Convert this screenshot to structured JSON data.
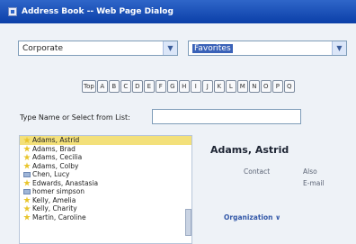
{
  "window": {
    "title": "Address Book -- Web Page Dialog"
  },
  "selects": {
    "directory": "Corporate",
    "group": "Favorites"
  },
  "alphabet": [
    "Top",
    "A",
    "B",
    "C",
    "D",
    "E",
    "F",
    "G",
    "H",
    "I",
    "J",
    "K",
    "L",
    "M",
    "N",
    "O",
    "P",
    "Q"
  ],
  "search": {
    "label": "Type Name or Select from List:",
    "value": ""
  },
  "contacts": [
    {
      "name": "Adams, Astrid",
      "icon": "star-icon",
      "selected": true
    },
    {
      "name": "Adams, Brad",
      "icon": "star-icon"
    },
    {
      "name": "Adams, Cecilia",
      "icon": "star-icon"
    },
    {
      "name": "Adams, Colby",
      "icon": "star-icon"
    },
    {
      "name": "Chen, Lucy",
      "icon": "contact-card-icon"
    },
    {
      "name": "Edwards, Anastasia",
      "icon": "star-icon"
    },
    {
      "name": "homer simpson",
      "icon": "contact-card-icon"
    },
    {
      "name": "Kelly, Amelia",
      "icon": "star-icon"
    },
    {
      "name": "Kelly, Charity",
      "icon": "star-icon"
    },
    {
      "name": "Martin, Caroline",
      "icon": "star-icon"
    }
  ],
  "detail": {
    "name": "Adams, Astrid",
    "contact_label": "Contact",
    "field_1": "Also",
    "field_2": "E-mail",
    "organization_label": "Organization ∨"
  },
  "colors": {
    "titlebar": "#1f57c2",
    "selected_row": "#f3e07a",
    "link": "#3358a8"
  }
}
